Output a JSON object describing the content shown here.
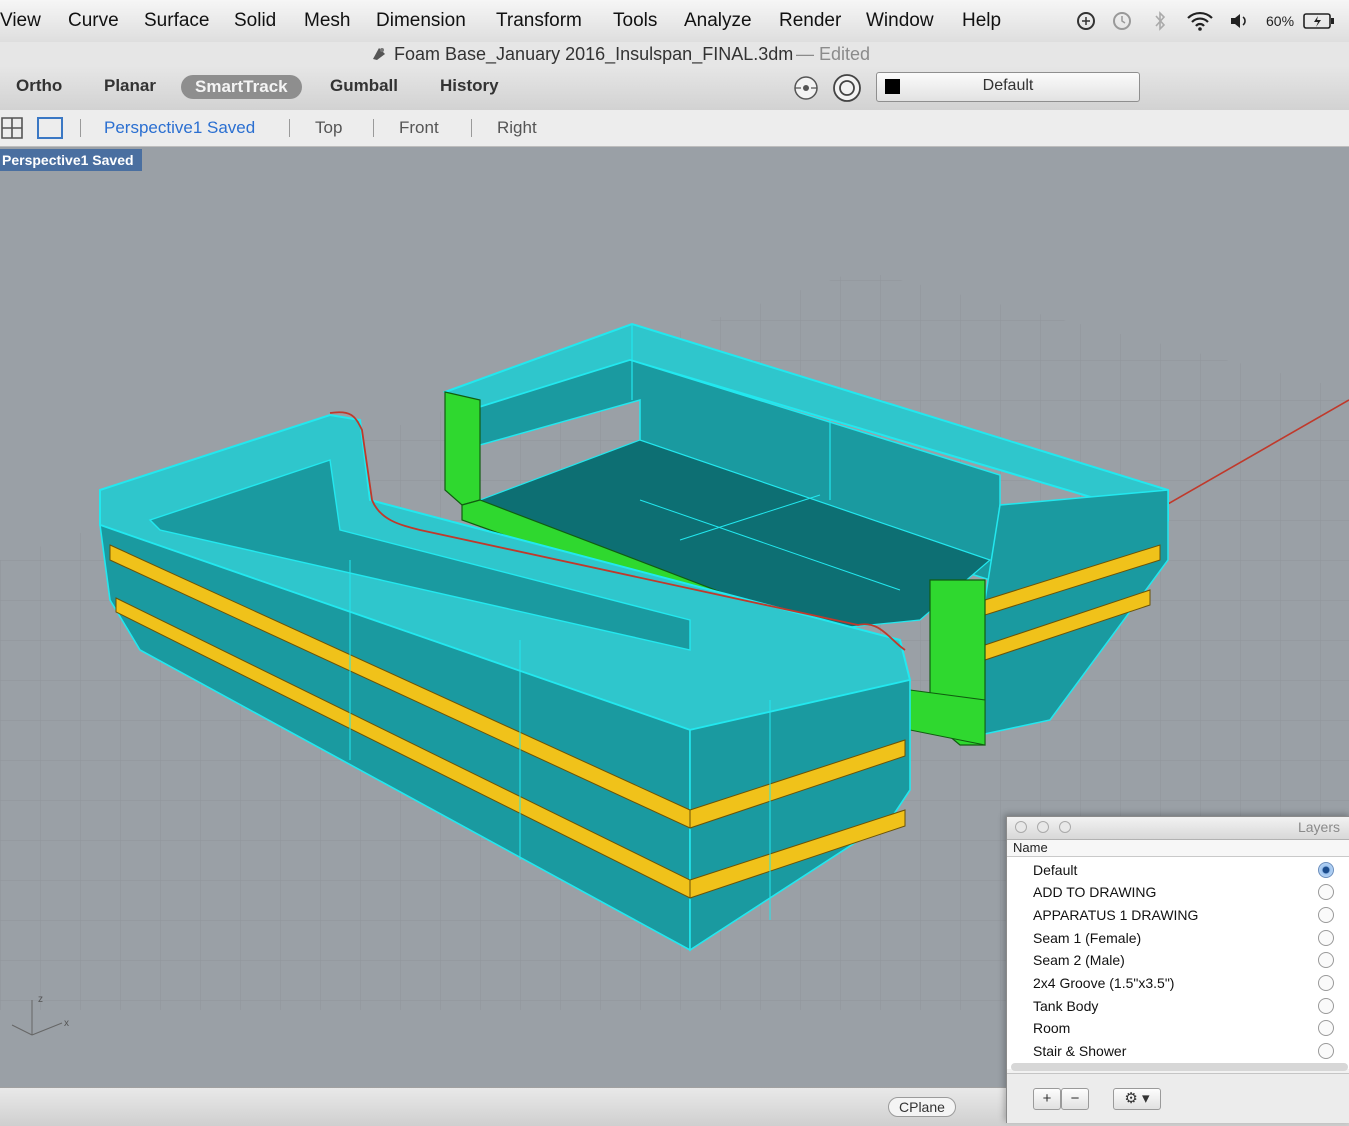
{
  "menubar": {
    "items": [
      "View",
      "Curve",
      "Surface",
      "Solid",
      "Mesh",
      "Dimension",
      "Transform",
      "Tools",
      "Analyze",
      "Render",
      "Window",
      "Help"
    ],
    "battery": "60%"
  },
  "window": {
    "title": "Foam Base_January 2016_Insulspan_FINAL.3dm",
    "edited": "— Edited"
  },
  "toolbar": {
    "modes": [
      "Ortho",
      "Planar",
      "SmartTrack",
      "Gumball",
      "History"
    ],
    "current_layer": "Default"
  },
  "viewports": {
    "tabs": [
      "Perspective1 Saved",
      "Top",
      "Front",
      "Right"
    ],
    "active_label": "Perspective1 Saved",
    "axis_labels": {
      "z": "z",
      "x": "x"
    }
  },
  "statusbar": {
    "cplane": "CPlane"
  },
  "layers_panel": {
    "title": "Layers",
    "column_name": "Name",
    "layers": [
      {
        "name": "Default",
        "current": true
      },
      {
        "name": "ADD TO DRAWING",
        "current": false
      },
      {
        "name": "APPARATUS 1 DRAWING",
        "current": false
      },
      {
        "name": "Seam 1 (Female)",
        "current": false
      },
      {
        "name": "Seam 2 (Male)",
        "current": false
      },
      {
        "name": "2x4 Groove (1.5\"x3.5\")",
        "current": false
      },
      {
        "name": "Tank Body",
        "current": false
      },
      {
        "name": "Room",
        "current": false
      },
      {
        "name": "Stair & Shower",
        "current": false
      }
    ],
    "add_label": "+",
    "remove_label": "−",
    "options_label": "⚙ ▾"
  },
  "colors": {
    "cyan": "#22e8ef",
    "teal": "#1a9aa0",
    "teal_dark": "#0d6f73",
    "yellow": "#f0c21a",
    "green": "#2fd82f",
    "red_curve": "#c0392b",
    "viewport_bg": "#9aa0a6"
  }
}
